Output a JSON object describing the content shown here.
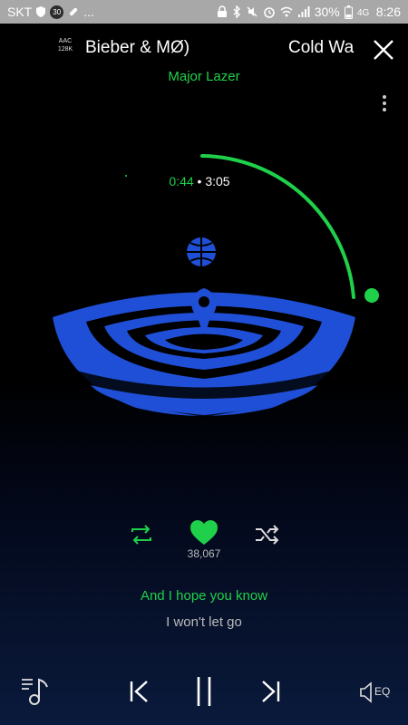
{
  "status_bar": {
    "carrier": "SKT",
    "notification_badge": "30",
    "ellipsis": "...",
    "battery": "30%",
    "time": "8:26"
  },
  "header": {
    "format_line1": "AAC",
    "format_line2": "128K",
    "title_scroll_text": "Bieber & MØ)",
    "title_next_text": "Cold Wa",
    "artist": "Major Lazer"
  },
  "player": {
    "elapsed": "0:44",
    "separator": "•",
    "total": "3:05",
    "progress": 0.24
  },
  "actions": {
    "like_count": "38,067"
  },
  "lyrics": {
    "current": "And I hope you know",
    "next": "I won't let go"
  },
  "controls": {
    "eq_label": "EQ"
  },
  "colors": {
    "accent": "#1fd14a",
    "artwork_blue": "#1f4fd6",
    "status_bar": "#a8a8a8"
  }
}
